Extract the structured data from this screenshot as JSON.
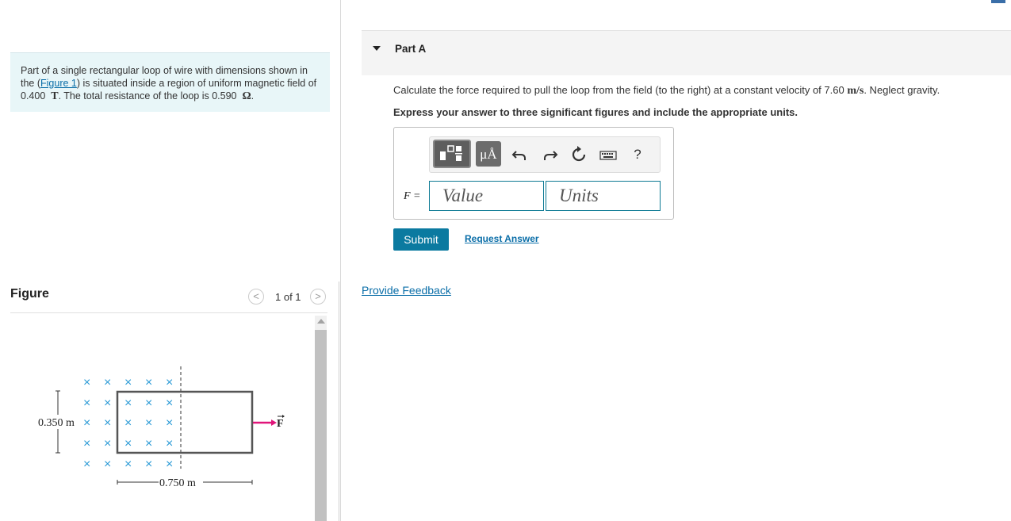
{
  "problem": {
    "text_1": "Part of a single rectangular loop of wire with dimensions shown in the (",
    "figure_link": "Figure 1",
    "text_2": ") is situated inside a region of uniform magnetic field of ",
    "field_value": "0.400",
    "field_unit": "T",
    "text_3": ". The total resistance of the loop is ",
    "resistance_value": "0.590",
    "resistance_unit": "Ω",
    "text_4": "."
  },
  "figure": {
    "title": "Figure",
    "pager": "1 of 1",
    "prev_glyph": "<",
    "next_glyph": ">",
    "height_label": "0.350 m",
    "width_label": "0.750 m",
    "force_label": "F",
    "field_symbol": "×",
    "colors": {
      "field_x": "#2a9ad6",
      "force_arrow": "#e0157a",
      "loop": "#555555"
    }
  },
  "part": {
    "title": "Part A",
    "question_pre": "Calculate the force required to pull the loop from the field (to the right) at a constant velocity of 7.60 ",
    "question_unit": "m/s",
    "question_post": ". Neglect gravity.",
    "instruction": "Express your answer to three significant figures and include the appropriate units.",
    "toolbar": {
      "units_button": "μÅ",
      "help": "?",
      "icons": [
        "templates-icon",
        "units-icon",
        "undo-icon",
        "redo-icon",
        "reset-icon",
        "keyboard-icon",
        "help-icon"
      ]
    },
    "variable_label": "F =",
    "value_placeholder": "Value",
    "units_placeholder": "Units",
    "submit_label": "Submit",
    "request_label": "Request Answer"
  },
  "feedback_label": "Provide Feedback",
  "colors": {
    "accent": "#0b7aa0",
    "link": "#0a6ea8",
    "problem_bg": "#e8f6f8"
  }
}
